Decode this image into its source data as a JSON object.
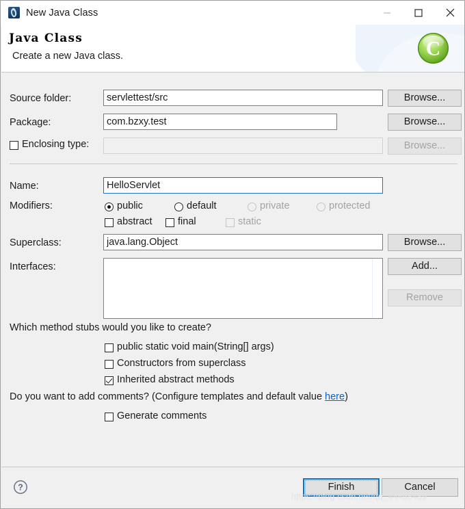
{
  "window": {
    "title": "New Java Class",
    "icon": "java-class-icon",
    "controls": {
      "minimize": "minimize-icon",
      "maximize": "maximize-icon",
      "close": "close-icon"
    }
  },
  "header": {
    "title": "Java Class",
    "subtitle": "Create a new Java class.",
    "banner_icon": "green-c-class-icon"
  },
  "form": {
    "source_folder": {
      "label": "Source folder:",
      "value": "servlettest/src",
      "browse": "Browse..."
    },
    "package": {
      "label": "Package:",
      "value": "com.bzxy.test",
      "browse": "Browse..."
    },
    "enclosing_type": {
      "label": "Enclosing type:",
      "checked": false,
      "value": "",
      "browse": "Browse...",
      "disabled": true
    },
    "name": {
      "label": "Name:",
      "value": "HelloServlet",
      "focused": true
    },
    "modifiers": {
      "label": "Modifiers:",
      "radios": [
        {
          "label": "public",
          "checked": true,
          "disabled": false
        },
        {
          "label": "default",
          "checked": false,
          "disabled": false
        },
        {
          "label": "private",
          "checked": false,
          "disabled": true
        },
        {
          "label": "protected",
          "checked": false,
          "disabled": true
        }
      ],
      "checkboxes": [
        {
          "label": "abstract",
          "checked": false,
          "disabled": false
        },
        {
          "label": "final",
          "checked": false,
          "disabled": false
        },
        {
          "label": "static",
          "checked": false,
          "disabled": true
        }
      ]
    },
    "superclass": {
      "label": "Superclass:",
      "value": "java.lang.Object",
      "browse": "Browse..."
    },
    "interfaces": {
      "label": "Interfaces:",
      "items": [],
      "add": "Add...",
      "remove": "Remove",
      "remove_disabled": true
    }
  },
  "stubs": {
    "question": "Which method stubs would you like to create?",
    "options": [
      {
        "label": "public static void main(String[] args)",
        "checked": false
      },
      {
        "label": "Constructors from superclass",
        "checked": false
      },
      {
        "label": "Inherited abstract methods",
        "checked": true
      }
    ]
  },
  "comments": {
    "question_prefix": "Do you want to add comments? (Configure templates and default value ",
    "link": "here",
    "question_suffix": ")",
    "option": {
      "label": "Generate comments",
      "checked": false
    }
  },
  "footer": {
    "help": "help-icon",
    "finish": "Finish",
    "cancel": "Cancel"
  },
  "watermark": "https://blog.csdn.net/qq_44458489",
  "colors": {
    "focus_border": "#1675c4",
    "link": "#0f62c4",
    "dialog_bg": "#f0f0f0",
    "banner_icon": "#7fc93a"
  }
}
